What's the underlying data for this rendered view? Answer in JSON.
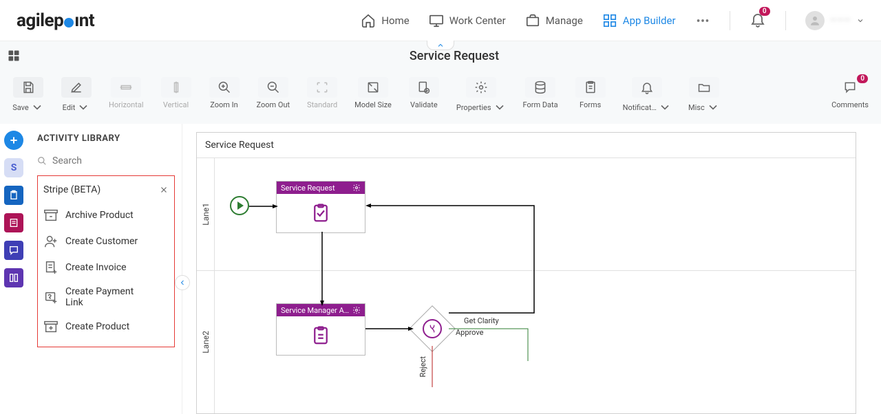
{
  "nav": {
    "home": "Home",
    "work_center": "Work Center",
    "manage": "Manage",
    "app_builder": "App Builder",
    "notif_count": "0",
    "user_name": "———"
  },
  "subheader": {
    "title": "Service Request"
  },
  "toolbar": {
    "save": "Save",
    "edit": "Edit",
    "horizontal": "Horizontal",
    "vertical": "Vertical",
    "zoom_in": "Zoom In",
    "zoom_out": "Zoom Out",
    "standard": "Standard",
    "model_size": "Model Size",
    "validate": "Validate",
    "properties": "Properties",
    "form_data": "Form Data",
    "forms": "Forms",
    "notifications": "Notificat…",
    "misc": "Misc",
    "comments": "Comments",
    "comments_count": "0"
  },
  "sidebar": {
    "title": "ACTIVITY LIBRARY",
    "search_placeholder": "Search",
    "group": "Stripe (BETA)",
    "items": [
      "Archive Product",
      "Create Customer",
      "Create Invoice",
      "Create Payment Link",
      "Create Product"
    ]
  },
  "canvas": {
    "title": "Service Request",
    "lane1": "Lane1",
    "lane2": "Lane2",
    "task1": "Service Request",
    "task2": "Service Manager Appr...",
    "edge_clarity": "Get Clarity",
    "edge_approve": "Approve",
    "edge_reject": "Reject"
  }
}
